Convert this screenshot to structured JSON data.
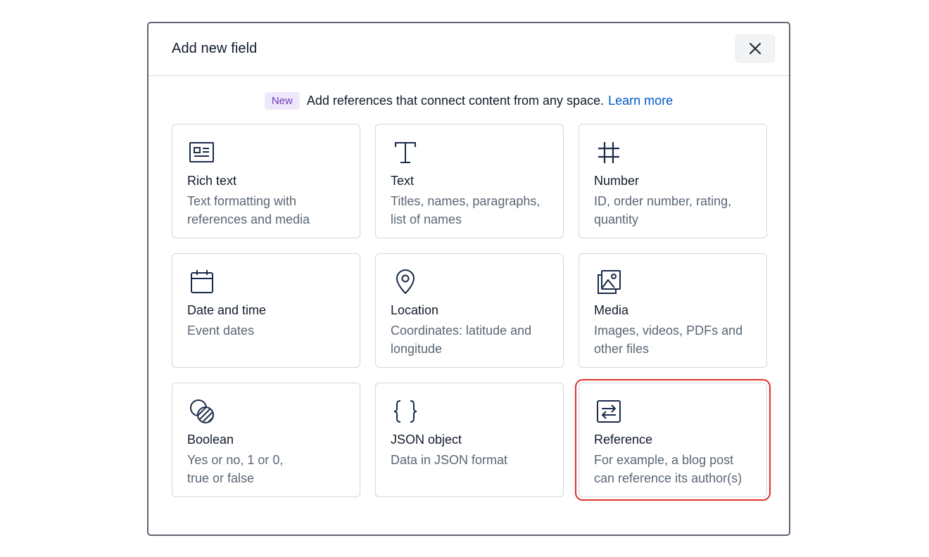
{
  "modal": {
    "title": "Add new field",
    "close_icon": "close-icon"
  },
  "banner": {
    "badge": "New",
    "text": "Add references that connect content from any space.",
    "link": "Learn more"
  },
  "field_types": [
    {
      "title": "Rich text",
      "desc_line1": "Text formatting with",
      "desc_line2": "references and media",
      "icon": "rich-text-icon"
    },
    {
      "title": "Text",
      "desc_line1": "Titles, names, paragraphs,",
      "desc_line2": "list of names",
      "icon": "text-icon"
    },
    {
      "title": "Number",
      "desc_line1": "ID, order number, rating,",
      "desc_line2": "quantity",
      "icon": "hash-icon"
    },
    {
      "title": "Date and time",
      "desc_line1": "Event dates",
      "desc_line2": "",
      "icon": "calendar-icon"
    },
    {
      "title": "Location",
      "desc_line1": "Coordinates: latitude and",
      "desc_line2": "longitude",
      "icon": "location-pin-icon"
    },
    {
      "title": "Media",
      "desc_line1": "Images, videos, PDFs and",
      "desc_line2": "other files",
      "icon": "media-icon"
    },
    {
      "title": "Boolean",
      "desc_line1": "Yes or no, 1 or 0,",
      "desc_line2": "true or false",
      "icon": "boolean-icon"
    },
    {
      "title": "JSON object",
      "desc_line1": "Data in JSON format",
      "desc_line2": "",
      "icon": "json-braces-icon"
    },
    {
      "title": "Reference",
      "desc_line1": "For example, a blog post",
      "desc_line2": "can reference its author(s)",
      "icon": "reference-arrows-icon"
    }
  ],
  "colors": {
    "highlight": "#e0302a",
    "badge_bg": "#efe7fb",
    "badge_text": "#6b3fbc",
    "link": "#0059c8",
    "icon_stroke": "#1a2b4a"
  }
}
